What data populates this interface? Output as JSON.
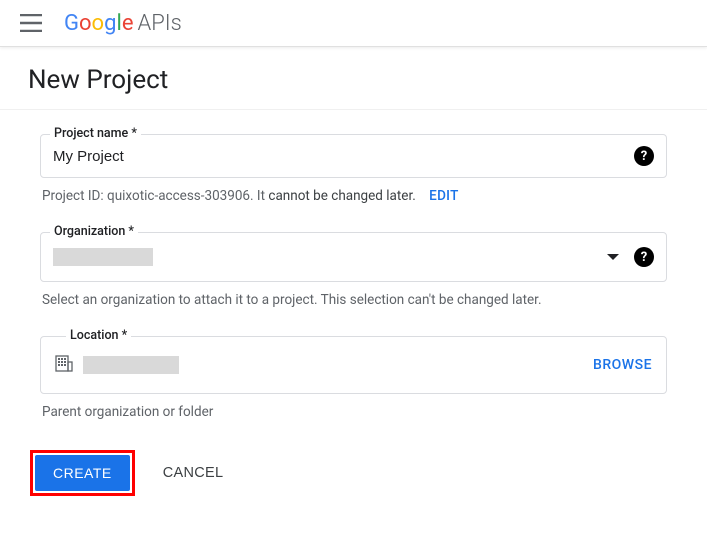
{
  "header": {
    "logo_brand": "Google",
    "logo_suffix": "APIs"
  },
  "page": {
    "title": "New Project"
  },
  "project_name": {
    "label": "Project name *",
    "value": "My Project"
  },
  "project_id": {
    "prefix": "Project ID: ",
    "id": "quixotic-access-303906",
    "suffix_light": ". It ",
    "suffix_dark": "cannot be changed later.",
    "edit": "EDIT"
  },
  "organization": {
    "label": "Organization *",
    "hint": "Select an organization to attach it to a project. This selection can't be changed later."
  },
  "location": {
    "label": "Location *",
    "browse": "BROWSE",
    "hint": "Parent organization or folder"
  },
  "actions": {
    "create": "CREATE",
    "cancel": "CANCEL"
  }
}
